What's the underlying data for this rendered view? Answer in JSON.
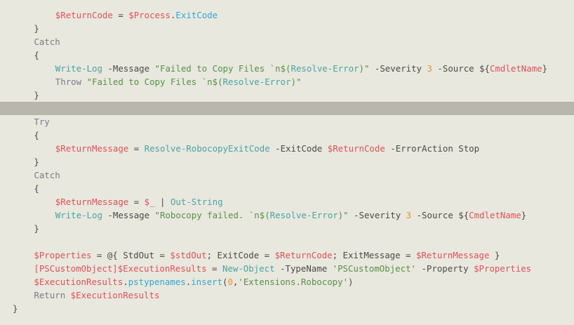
{
  "code_lines": [
    {
      "indent": 8,
      "tokens": [
        [
          "var",
          "$ReturnCode"
        ],
        [
          "pl",
          " = "
        ],
        [
          "var",
          "$Process"
        ],
        [
          "pl",
          "."
        ],
        [
          "prop",
          "ExitCode"
        ]
      ]
    },
    {
      "indent": 4,
      "tokens": [
        [
          "pl",
          "}"
        ]
      ]
    },
    {
      "indent": 4,
      "tokens": [
        [
          "kw",
          "Catch"
        ]
      ]
    },
    {
      "indent": 4,
      "tokens": [
        [
          "pl",
          "{"
        ]
      ]
    },
    {
      "indent": 8,
      "tokens": [
        [
          "fn",
          "Write-Log"
        ],
        [
          "pl",
          " -Message "
        ],
        [
          "str",
          "\"Failed to Copy Files `n$("
        ],
        [
          "fn",
          "Resolve-Error"
        ],
        [
          "str",
          ")\""
        ],
        [
          "pl",
          " -Severity "
        ],
        [
          "num",
          "3"
        ],
        [
          "pl",
          " -Source "
        ],
        [
          "pl",
          "${"
        ],
        [
          "var",
          "CmdletName"
        ],
        [
          "pl",
          "}"
        ]
      ]
    },
    {
      "indent": 8,
      "tokens": [
        [
          "kw",
          "Throw"
        ],
        [
          "pl",
          " "
        ],
        [
          "str",
          "\"Failed to Copy Files `n$("
        ],
        [
          "fn",
          "Resolve-Error"
        ],
        [
          "str",
          ")\""
        ]
      ]
    },
    {
      "indent": 4,
      "tokens": [
        [
          "pl",
          "}"
        ]
      ]
    },
    {
      "indent": 0,
      "highlight": true,
      "tokens": []
    },
    {
      "indent": 4,
      "tokens": [
        [
          "kw",
          "Try"
        ]
      ]
    },
    {
      "indent": 4,
      "tokens": [
        [
          "pl",
          "{"
        ]
      ]
    },
    {
      "indent": 8,
      "tokens": [
        [
          "var",
          "$ReturnMessage"
        ],
        [
          "pl",
          " = "
        ],
        [
          "fn",
          "Resolve-RobocopyExitCode"
        ],
        [
          "pl",
          " -ExitCode "
        ],
        [
          "var",
          "$ReturnCode"
        ],
        [
          "pl",
          " -ErrorAction Stop"
        ]
      ]
    },
    {
      "indent": 4,
      "tokens": [
        [
          "pl",
          "}"
        ]
      ]
    },
    {
      "indent": 4,
      "tokens": [
        [
          "kw",
          "Catch"
        ]
      ]
    },
    {
      "indent": 4,
      "tokens": [
        [
          "pl",
          "{"
        ]
      ]
    },
    {
      "indent": 8,
      "tokens": [
        [
          "var",
          "$ReturnMessage"
        ],
        [
          "pl",
          " = "
        ],
        [
          "var",
          "$_"
        ],
        [
          "pl",
          " | "
        ],
        [
          "fn",
          "Out-String"
        ]
      ]
    },
    {
      "indent": 8,
      "tokens": [
        [
          "fn",
          "Write-Log"
        ],
        [
          "pl",
          " -Message "
        ],
        [
          "str",
          "\"Robocopy failed. `n$("
        ],
        [
          "fn",
          "Resolve-Error"
        ],
        [
          "str",
          ")\""
        ],
        [
          "pl",
          " -Severity "
        ],
        [
          "num",
          "3"
        ],
        [
          "pl",
          " -Source "
        ],
        [
          "pl",
          "${"
        ],
        [
          "var",
          "CmdletName"
        ],
        [
          "pl",
          "}"
        ]
      ]
    },
    {
      "indent": 4,
      "tokens": [
        [
          "pl",
          "}"
        ]
      ]
    },
    {
      "indent": 0,
      "tokens": []
    },
    {
      "indent": 4,
      "tokens": [
        [
          "var",
          "$Properties"
        ],
        [
          "pl",
          " = @{ StdOut = "
        ],
        [
          "var",
          "$stdOut"
        ],
        [
          "pl",
          "; ExitCode = "
        ],
        [
          "var",
          "$ReturnCode"
        ],
        [
          "pl",
          "; ExitMessage = "
        ],
        [
          "var",
          "$ReturnMessage"
        ],
        [
          "pl",
          " }"
        ]
      ]
    },
    {
      "indent": 4,
      "tokens": [
        [
          "type",
          "[PSCustomObject]"
        ],
        [
          "var",
          "$ExecutionResults"
        ],
        [
          "pl",
          " = "
        ],
        [
          "fn",
          "New-Object"
        ],
        [
          "pl",
          " -TypeName "
        ],
        [
          "str",
          "'PSCustomObject'"
        ],
        [
          "pl",
          " -Property "
        ],
        [
          "var",
          "$Properties"
        ]
      ]
    },
    {
      "indent": 4,
      "tokens": [
        [
          "var",
          "$ExecutionResults"
        ],
        [
          "pl",
          "."
        ],
        [
          "prop",
          "pstypenames"
        ],
        [
          "pl",
          "."
        ],
        [
          "prop",
          "insert"
        ],
        [
          "pl",
          "("
        ],
        [
          "num",
          "0"
        ],
        [
          "pl",
          ","
        ],
        [
          "str",
          "'Extensions.Robocopy'"
        ],
        [
          "pl",
          ")"
        ]
      ]
    },
    {
      "indent": 4,
      "tokens": [
        [
          "kw",
          "Return"
        ],
        [
          "pl",
          " "
        ],
        [
          "var",
          "$ExecutionResults"
        ]
      ]
    },
    {
      "indent": 0,
      "tokens": [
        [
          "pl",
          "}"
        ]
      ]
    }
  ]
}
